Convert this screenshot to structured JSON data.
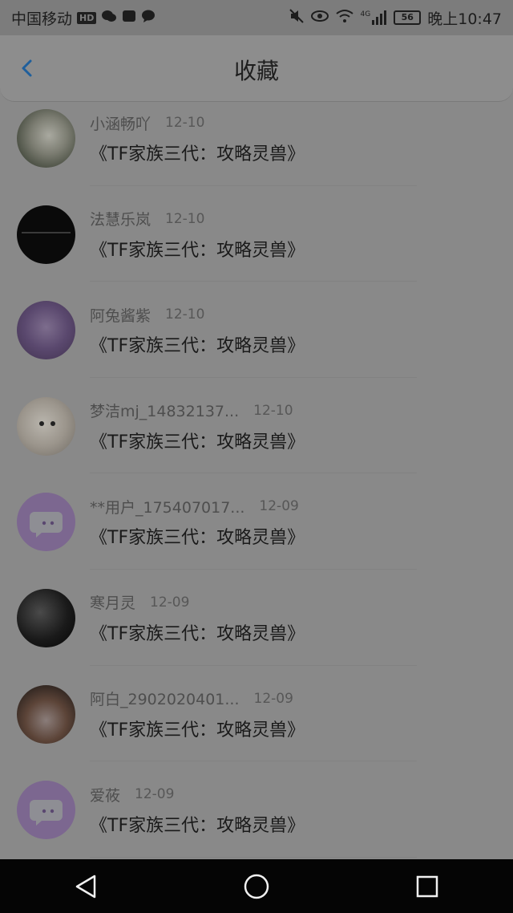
{
  "status_bar": {
    "carrier": "中国移动",
    "hd_badge": "HD",
    "battery_level": "56",
    "network": "4G",
    "time": "晚上10:47",
    "icons": [
      "wechat-icon",
      "app-icon",
      "message-icon",
      "mute-icon",
      "eye-icon",
      "wifi-icon",
      "signal-icon",
      "battery-icon"
    ]
  },
  "header": {
    "title": "收藏"
  },
  "items": [
    {
      "name": "小涵畅吖",
      "date": "12-10",
      "content": "《TF家族三代：攻略灵兽》",
      "avatar": "photo"
    },
    {
      "name": "法慧乐岚",
      "date": "12-10",
      "content": "《TF家族三代：攻略灵兽》",
      "avatar": "black"
    },
    {
      "name": "阿兔酱紫",
      "date": "12-10",
      "content": "《TF家族三代：攻略灵兽》",
      "avatar": "purple"
    },
    {
      "name": "梦洁mj_14832137...",
      "date": "12-10",
      "content": "《TF家族三代：攻略灵兽》",
      "avatar": "dog"
    },
    {
      "name": "**用户_175407017...",
      "date": "12-09",
      "content": "《TF家族三代：攻略灵兽》",
      "avatar": "chat"
    },
    {
      "name": "寒月灵",
      "date": "12-09",
      "content": "《TF家族三代：攻略灵兽》",
      "avatar": "dark"
    },
    {
      "name": "阿白_2902020401...",
      "date": "12-09",
      "content": "《TF家族三代：攻略灵兽》",
      "avatar": "anime"
    },
    {
      "name": "爱莜",
      "date": "12-09",
      "content": "《TF家族三代：攻略灵兽》",
      "avatar": "chat"
    }
  ],
  "colors": {
    "accent": "#1f5f9c",
    "overlay_background": "#898989",
    "nav_bar": "#050505"
  }
}
